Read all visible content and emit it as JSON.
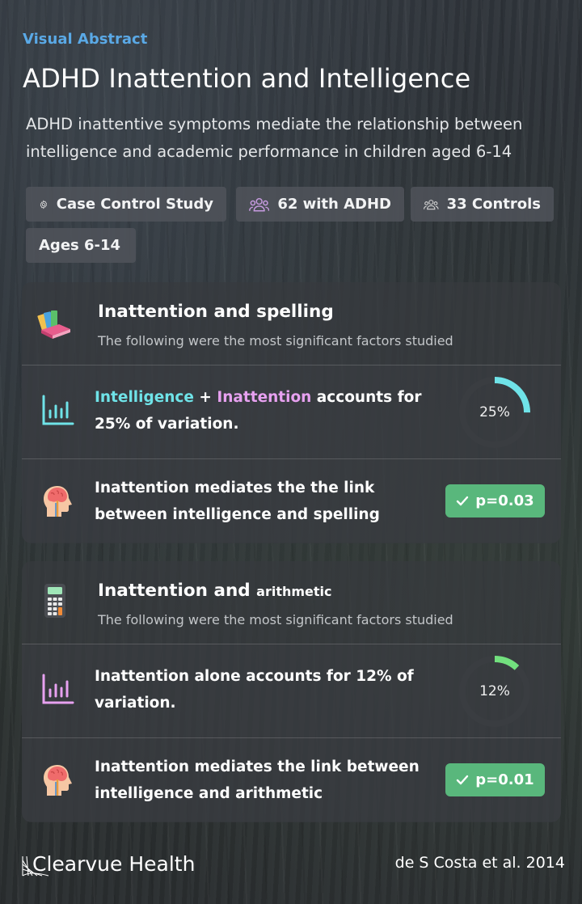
{
  "header": {
    "eyebrow": "Visual Abstract",
    "title": "ADHD Inattention and Intelligence",
    "subtitle": "ADHD inattentive symptoms mediate the relationship between intelligence and academic performance in children aged 6-14"
  },
  "tags": [
    {
      "label": "Case Control Study",
      "icon": "gear-icon"
    },
    {
      "label": "62 with ADHD",
      "icon": "group-icon"
    },
    {
      "label": "33 Controls",
      "icon": "group-icon"
    },
    {
      "label": "Ages 6-14"
    }
  ],
  "sections": [
    {
      "title": "Inattention and spelling",
      "subtitle": "The following were the most significant factors studied",
      "icon": "books-icon",
      "finding": {
        "part1": "Intelligence",
        "plus": " + ",
        "part2": "Inattention",
        "rest": " accounts for 25% of variation.",
        "gauge_label": "25%",
        "gauge_value": 0.25,
        "gauge_color": "#6fe3e8",
        "icon": "bar-chart-icon"
      },
      "mediation": {
        "text": "Inattention mediates the the link between intelligence and spelling",
        "badge": "p=0.03",
        "icon": "brain-head-icon"
      }
    },
    {
      "title_main": "Inattention and ",
      "title_small": "arithmetic",
      "subtitle": "The following were the most significant factors studied",
      "icon": "calculator-icon",
      "finding": {
        "text": "Inattention alone accounts for 12% of variation.",
        "gauge_label": "12%",
        "gauge_value": 0.12,
        "gauge_color": "#72e07e",
        "icon": "bar-chart-icon"
      },
      "mediation": {
        "text": "Inattention mediates the link between intelligence and arithmetic",
        "badge": "p=0.01",
        "icon": "brain-head-icon"
      }
    }
  ],
  "footer": {
    "brand": "Clearvue Health",
    "citation": "de S Costa et al. 2014"
  },
  "colors": {
    "eyebrow": "#5aa9e6",
    "badge": "#59b77c",
    "intelligence": "#6fe3e8",
    "inattention": "#e7a1f0"
  }
}
